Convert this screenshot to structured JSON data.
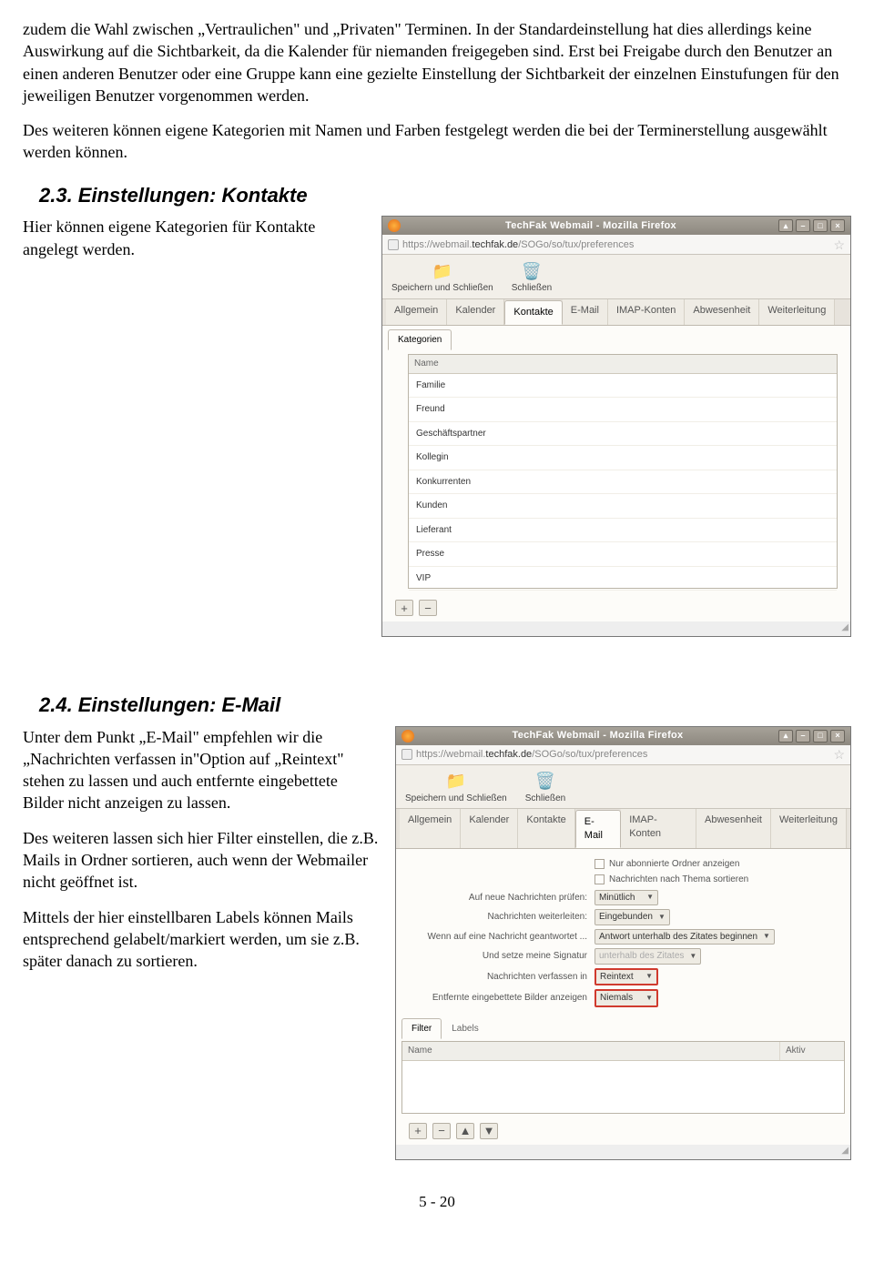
{
  "paragraphs": {
    "p1": "zudem die Wahl zwischen „Vertraulichen\" und „Privaten\" Terminen. In der Standardeinstellung hat dies allerdings keine Auswirkung auf die Sichtbarkeit, da die Kalender für niemanden freigegeben sind. Erst bei Freigabe durch den Benutzer an einen anderen Benutzer oder eine Gruppe kann eine gezielte Einstellung der Sichtbarkeit der einzelnen Einstufungen für den jeweiligen Benutzer vorgenommen werden.",
    "p2": "Des weiteren können eigene Kategorien mit Namen und Farben festgelegt werden die bei der Terminerstellung ausgewählt werden können.",
    "p3": "Hier können eigene Kategorien für Kontakte angelegt werden.",
    "p4a": "Unter dem Punkt „E-Mail\" empfehlen wir die „Nachrichten verfassen in\"Option auf „Reintext\" stehen zu lassen und auch entfernte eingebettete Bilder nicht anzeigen zu lassen.",
    "p4b": "Des weiteren lassen sich hier Filter einstellen, die z.B. Mails in Ordner sortieren, auch wenn der Webmailer nicht geöffnet ist.",
    "p4c": "Mittels der hier einstellbaren Labels können Mails entsprechend gelabelt/markiert werden, um sie z.B. später danach zu sortieren."
  },
  "headings": {
    "s23": "2.3. Einstellungen: Kontakte",
    "s24": "2.4. Einstellungen: E-Mail"
  },
  "window": {
    "title": "TechFak Webmail - Mozilla Firefox",
    "url_prefix": "https://webmail.",
    "url_host": "techfak.de",
    "url_path": "/SOGo/so/tux/preferences"
  },
  "toolbar": {
    "save_close": "Speichern und Schließen",
    "close": "Schließen"
  },
  "tabs": {
    "allgemein": "Allgemein",
    "kalender": "Kalender",
    "kontakte": "Kontakte",
    "email": "E-Mail",
    "imap": "IMAP-Konten",
    "abwesenheit": "Abwesenheit",
    "weiterleitung": "Weiterleitung"
  },
  "subtab": {
    "kategorien": "Kategorien"
  },
  "list": {
    "header": "Name",
    "items": [
      "Familie",
      "Freund",
      "Geschäftspartner",
      "Kollegin",
      "Konkurrenten",
      "Kunden",
      "Lieferant",
      "Presse",
      "VIP"
    ]
  },
  "email_form": {
    "chk1": "Nur abonnierte Ordner anzeigen",
    "chk2": "Nachrichten nach Thema sortieren",
    "lbl_check": "Auf neue Nachrichten prüfen:",
    "val_check": "Minütlich",
    "lbl_fwd": "Nachrichten weiterleiten:",
    "val_fwd": "Eingebunden",
    "lbl_reply": "Wenn auf eine Nachricht geantwortet ...",
    "val_reply": "Antwort unterhalb des Zitates beginnen",
    "lbl_sig": "Und setze meine Signatur",
    "val_sig": "unterhalb des Zitates",
    "lbl_compose": "Nachrichten verfassen in",
    "val_compose": "Reintext",
    "lbl_img": "Entfernte eingebettete Bilder anzeigen",
    "val_img": "Niemals"
  },
  "filter_tabs": {
    "filter": "Filter",
    "labels": "Labels"
  },
  "filter_cols": {
    "name": "Name",
    "aktiv": "Aktiv"
  },
  "page_number": "5 - 20"
}
